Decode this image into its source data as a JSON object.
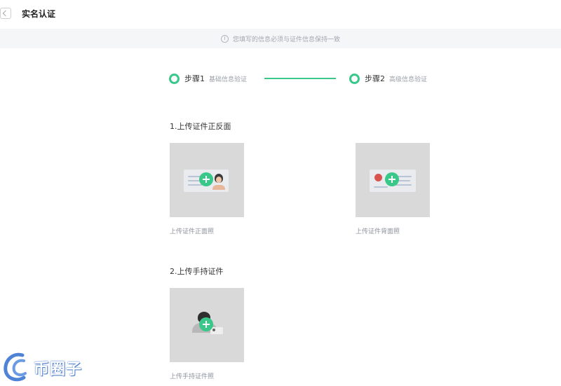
{
  "header": {
    "title": "实名认证"
  },
  "notice": {
    "icon": "info-icon",
    "text": "您填写的信息必须与证件信息保持一致"
  },
  "steps": [
    {
      "title": "步骤1",
      "desc": "基础信息验证",
      "status": "active"
    },
    {
      "title": "步骤2",
      "desc": "高级信息验证",
      "status": "active"
    }
  ],
  "sections": [
    {
      "title": "1.上传证件正反面",
      "cards": [
        {
          "label": "上传证件正面照"
        },
        {
          "label": "上传证件背面照"
        }
      ]
    },
    {
      "title": "2.上传手持证件",
      "cards": [
        {
          "label": "上传手持证件照"
        }
      ]
    }
  ],
  "watermark": {
    "text": "币圈子"
  },
  "colors": {
    "accent": "#3ac78a",
    "card_bg": "#d9d9d9",
    "notice_bg": "#f5f6f8"
  }
}
